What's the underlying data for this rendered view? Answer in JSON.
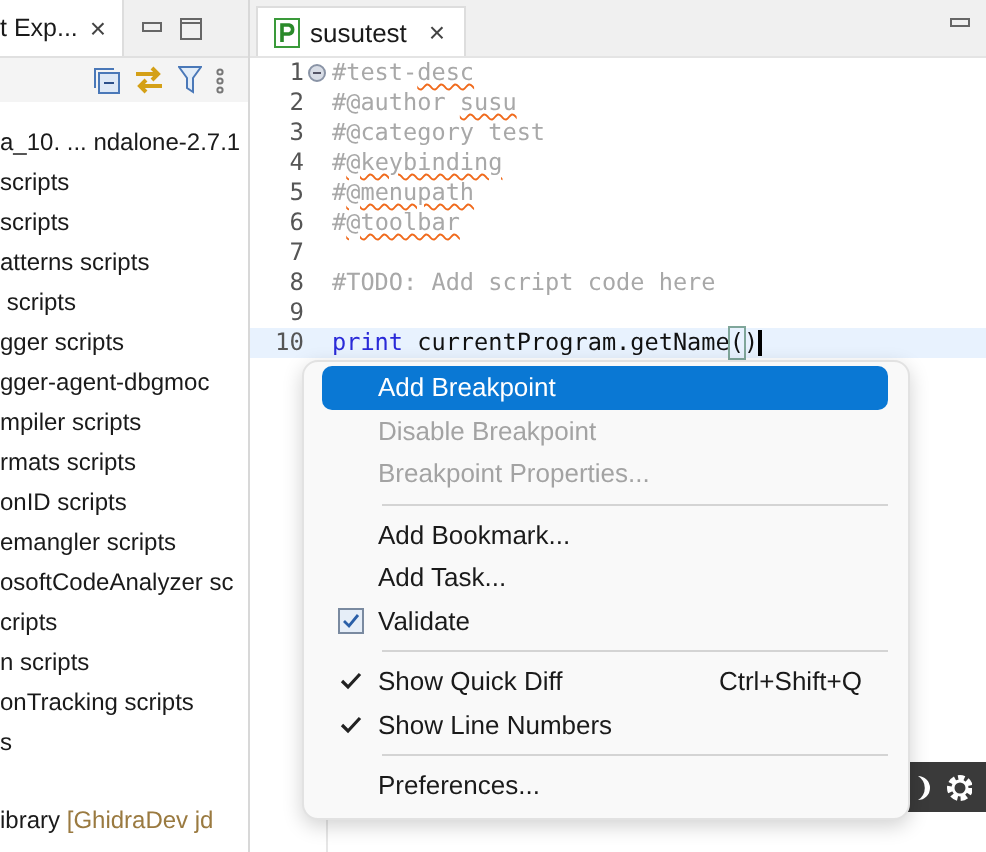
{
  "explorer": {
    "tab_label": "t Exp...",
    "close": "×",
    "items": [
      {
        "label": "a_10. ... ndalone-2.7.1"
      },
      {
        "label": "scripts"
      },
      {
        "label": "scripts"
      },
      {
        "label": "atterns scripts"
      },
      {
        "label": " scripts"
      },
      {
        "label": "gger scripts"
      },
      {
        "label": "gger-agent-dbgmoc"
      },
      {
        "label": "mpiler scripts"
      },
      {
        "label": "rmats scripts"
      },
      {
        "label": "onID scripts"
      },
      {
        "label": "emangler scripts"
      },
      {
        "label": "osoftCodeAnalyzer sc"
      },
      {
        "label": "cripts"
      },
      {
        "label": "n scripts"
      },
      {
        "label": "onTracking scripts"
      },
      {
        "label": "s"
      }
    ],
    "footer_item": {
      "label": "ibrary",
      "decoration": "[GhidraDev jd"
    }
  },
  "editor": {
    "tab_label": "susutest",
    "close": "×",
    "lines": [
      {
        "number": "1",
        "foldable": true,
        "current": false,
        "segments": [
          {
            "text": "#test-",
            "kind": "comment"
          },
          {
            "text": "desc",
            "kind": "misspelled"
          }
        ]
      },
      {
        "number": "2",
        "foldable": false,
        "current": false,
        "segments": [
          {
            "text": "#@author ",
            "kind": "comment"
          },
          {
            "text": "susu",
            "kind": "misspelled"
          }
        ]
      },
      {
        "number": "3",
        "foldable": false,
        "current": false,
        "segments": [
          {
            "text": "#@category test",
            "kind": "comment"
          }
        ]
      },
      {
        "number": "4",
        "foldable": false,
        "current": false,
        "segments": [
          {
            "text": "#",
            "kind": "comment"
          },
          {
            "text": "@keybinding",
            "kind": "misspelled"
          }
        ]
      },
      {
        "number": "5",
        "foldable": false,
        "current": false,
        "segments": [
          {
            "text": "#",
            "kind": "comment"
          },
          {
            "text": "@menupath",
            "kind": "misspelled"
          }
        ]
      },
      {
        "number": "6",
        "foldable": false,
        "current": false,
        "segments": [
          {
            "text": "#",
            "kind": "comment"
          },
          {
            "text": "@toolbar",
            "kind": "misspelled"
          }
        ]
      },
      {
        "number": "7",
        "foldable": false,
        "current": false
      },
      {
        "number": "8",
        "foldable": false,
        "current": false,
        "segments": [
          {
            "text": "#TODO: Add script code here",
            "kind": "comment"
          }
        ]
      },
      {
        "number": "9",
        "foldable": false,
        "current": false
      },
      {
        "number": "10",
        "foldable": false,
        "current": true,
        "segments": [
          {
            "text": "print",
            "kind": "keyword"
          },
          {
            "text": " currentProgram.getName",
            "kind": "plain"
          },
          {
            "text": "(",
            "kind": "bracket"
          },
          {
            "text": ")",
            "kind": "plain"
          }
        ]
      }
    ]
  },
  "context_menu": {
    "items": [
      {
        "kind": "action",
        "label": "Add Breakpoint",
        "selected": true,
        "disabled": false
      },
      {
        "kind": "action",
        "label": "Disable Breakpoint",
        "selected": false,
        "disabled": true
      },
      {
        "kind": "action",
        "label": "Breakpoint Properties...",
        "selected": false,
        "disabled": true
      },
      {
        "kind": "separator"
      },
      {
        "kind": "action",
        "label": "Add Bookmark...",
        "selected": false,
        "disabled": false
      },
      {
        "kind": "action",
        "label": "Add Task...",
        "selected": false,
        "disabled": false
      },
      {
        "kind": "checkbox",
        "label": "Validate",
        "checked": true
      },
      {
        "kind": "separator"
      },
      {
        "kind": "toggle",
        "label": "Show Quick Diff",
        "shortcut": "Ctrl+Shift+Q",
        "checked": true
      },
      {
        "kind": "toggle",
        "label": "Show Line Numbers",
        "checked": true
      },
      {
        "kind": "separator"
      },
      {
        "kind": "action",
        "label": "Preferences...",
        "selected": false,
        "disabled": false
      }
    ]
  }
}
